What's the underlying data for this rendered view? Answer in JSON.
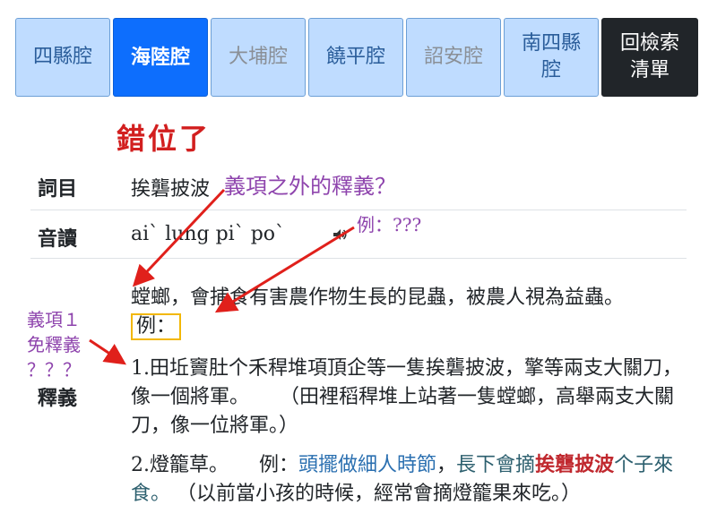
{
  "tabs": [
    {
      "label": "四縣腔",
      "state": "normal"
    },
    {
      "label": "海陸腔",
      "state": "active"
    },
    {
      "label": "大埔腔",
      "state": "dim"
    },
    {
      "label": "饒平腔",
      "state": "normal"
    },
    {
      "label": "詔安腔",
      "state": "dim"
    },
    {
      "label": "南四縣腔",
      "state": "normal"
    },
    {
      "label": "回檢索清單",
      "state": "dark"
    }
  ],
  "annotations": {
    "misplaced": "錯位了",
    "question_beyond": "義項之外的釋義？",
    "example_q": "例：???",
    "item1_line1": "義項１",
    "item1_line2": "免釋義",
    "item1_line3": "？？？"
  },
  "entry": {
    "headword_label": "詞目",
    "headword": "挨礱披波",
    "pronunciation_label": "音讀",
    "pronunciation": "ai` lung pi` po`",
    "definition_label": "釋義",
    "general_def": "螳螂，會捕食有害農作物生長的昆蟲，被農人視為益蟲。",
    "general_example_label": "例："
  },
  "senses": [
    {
      "text": "1.田坵竇肚个禾稈堆項頂企等一隻挨礱披波，擎等兩支大關刀，像一個將軍。",
      "translation": "（田裡稻稈堆上站著一隻螳螂，高舉兩支大關刀，像一位將軍。）"
    },
    {
      "text": "2.燈籠草。",
      "example_label": "例：",
      "example_part1": "頭擺做細人時節",
      "comma": "，",
      "example_part2": "長下會摘",
      "highlight": "挨礱披波",
      "example_part3": "个子來食。",
      "translation": "（以前當小孩的時候，經常會摘燈籠果來吃。）"
    }
  ]
}
